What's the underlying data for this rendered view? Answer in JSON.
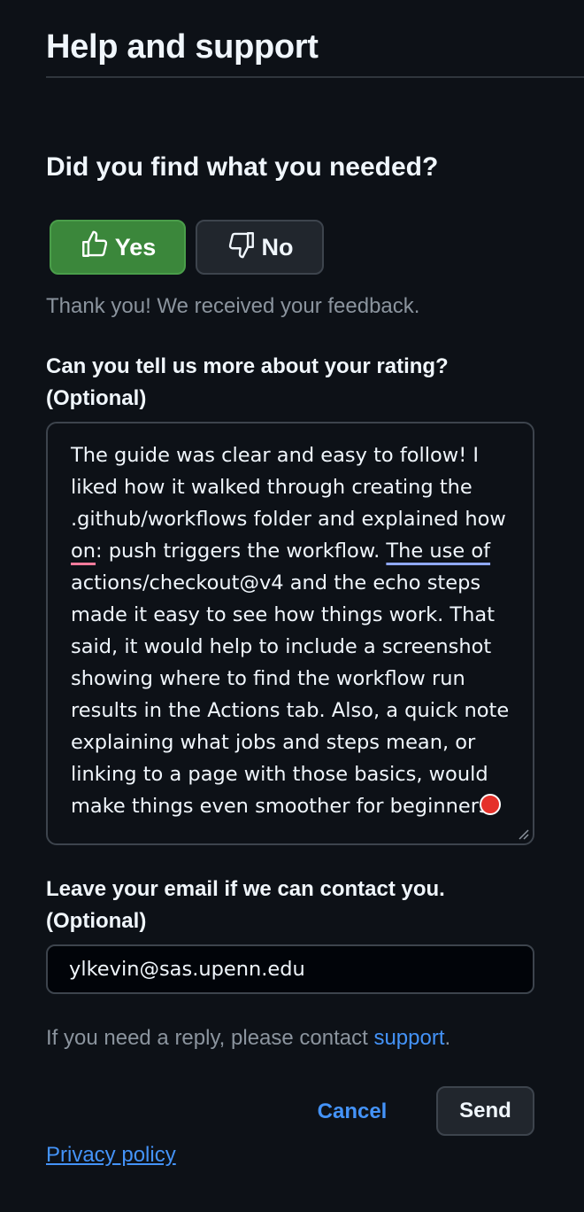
{
  "header": {
    "title": "Help and support"
  },
  "feedback": {
    "question": "Did you find what you needed?",
    "yes_label": "Yes",
    "no_label": "No",
    "thanks_message": "Thank you! We received your feedback."
  },
  "rating_details": {
    "label_line1": "Can you tell us more about your rating?",
    "label_line2": "(Optional)",
    "text_part1": "The guide was clear and easy to follow! I liked how it walked through creating the .github/workflows folder and explained how ",
    "text_misspelled": "on",
    "text_part2": ": push triggers the workflow. ",
    "text_grammar_flag": "The use of",
    "text_part3": " actions/checkout@v4 and the echo steps made it easy to see how things work. That said, it would help to include a screenshot showing where to find the workflow run results in the Actions tab. Also, a quick note explaining what jobs and steps mean, or linking to a page with those basics, would make things even smoother for beginners."
  },
  "email": {
    "label_line1": "Leave your email if we can contact you.",
    "label_line2": "(Optional)",
    "value": "ylkevin@sas.upenn.edu"
  },
  "reply_note": {
    "prefix": "If you need a reply, please contact ",
    "link_text": "support",
    "suffix": "."
  },
  "actions": {
    "cancel_label": "Cancel",
    "send_label": "Send"
  },
  "footer": {
    "privacy_label": "Privacy policy"
  },
  "colors": {
    "background": "#0d1117",
    "yes_button": "#3b873b",
    "link": "#4493f8",
    "muted_text": "#8b949e",
    "border": "#3d444d"
  }
}
